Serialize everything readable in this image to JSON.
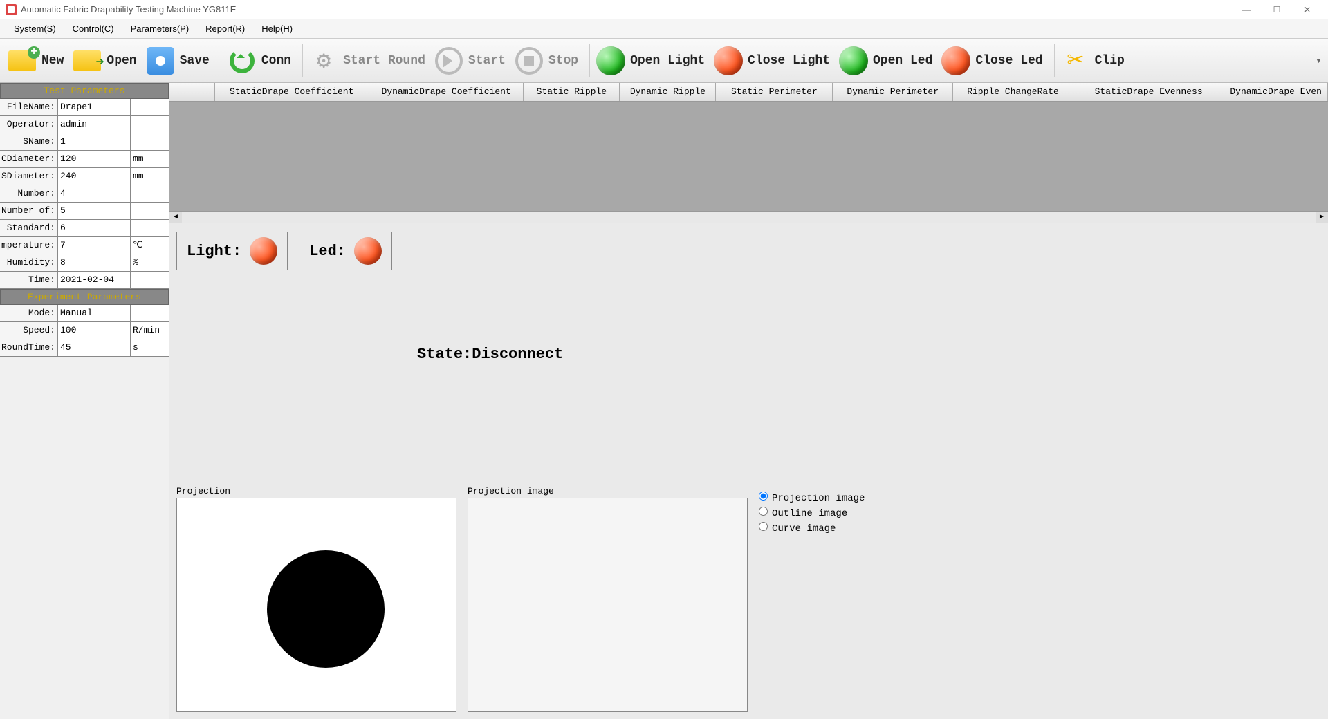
{
  "window": {
    "title": "Automatic Fabric Drapability Testing Machine YG811E"
  },
  "menu": {
    "system": "System(S)",
    "control": "Control(C)",
    "parameters": "Parameters(P)",
    "report": "Report(R)",
    "help": "Help(H)"
  },
  "toolbar": {
    "new": "New",
    "open": "Open",
    "save": "Save",
    "conn": "Conn",
    "start_round": "Start Round",
    "start": "Start",
    "stop": "Stop",
    "open_light": "Open Light",
    "close_light": "Close Light",
    "open_led": "Open Led",
    "close_led": "Close Led",
    "clip": "Clip"
  },
  "columns": {
    "c1": "StaticDrape Coefficient",
    "c2": "DynamicDrape Coefficient",
    "c3": "Static Ripple",
    "c4": "Dynamic Ripple",
    "c5": "Static Perimeter",
    "c6": "Dynamic Perimeter",
    "c7": "Ripple ChangeRate",
    "c8": "StaticDrape Evenness",
    "c9": "DynamicDrape Even"
  },
  "sidebar": {
    "test_head": "Test Parameters",
    "exp_head": "Experiment Parameters",
    "rows": {
      "filename": {
        "label": "FileName:",
        "value": "Drape1",
        "unit": ""
      },
      "operator": {
        "label": "Operator:",
        "value": "admin",
        "unit": ""
      },
      "sname": {
        "label": "SName:",
        "value": "1",
        "unit": ""
      },
      "cdiameter": {
        "label": "CDiameter:",
        "value": "120",
        "unit": "mm"
      },
      "sdiameter": {
        "label": "SDiameter:",
        "value": "240",
        "unit": "mm"
      },
      "number": {
        "label": "Number:",
        "value": "4",
        "unit": ""
      },
      "numberof": {
        "label": "Number of:",
        "value": "5",
        "unit": ""
      },
      "standard": {
        "label": "Standard:",
        "value": "6",
        "unit": ""
      },
      "temperature": {
        "label": "mperature:",
        "value": "7",
        "unit": "℃"
      },
      "humidity": {
        "label": "Humidity:",
        "value": "8",
        "unit": "%"
      },
      "time": {
        "label": "Time:",
        "value": "2021-02-04",
        "unit": ""
      },
      "mode": {
        "label": "Mode:",
        "value": "Manual",
        "unit": ""
      },
      "speed": {
        "label": "Speed:",
        "value": "100",
        "unit": "R/min"
      },
      "roundtime": {
        "label": "RoundTime:",
        "value": "45",
        "unit": "s"
      }
    }
  },
  "status": {
    "light_label": "Light:",
    "led_label": "Led:",
    "state_label": "State:Disconnect"
  },
  "panels": {
    "projection": "Projection",
    "projection_image": "Projection image"
  },
  "radios": {
    "projection": "Projection image",
    "outline": "Outline image",
    "curve": "Curve image"
  }
}
